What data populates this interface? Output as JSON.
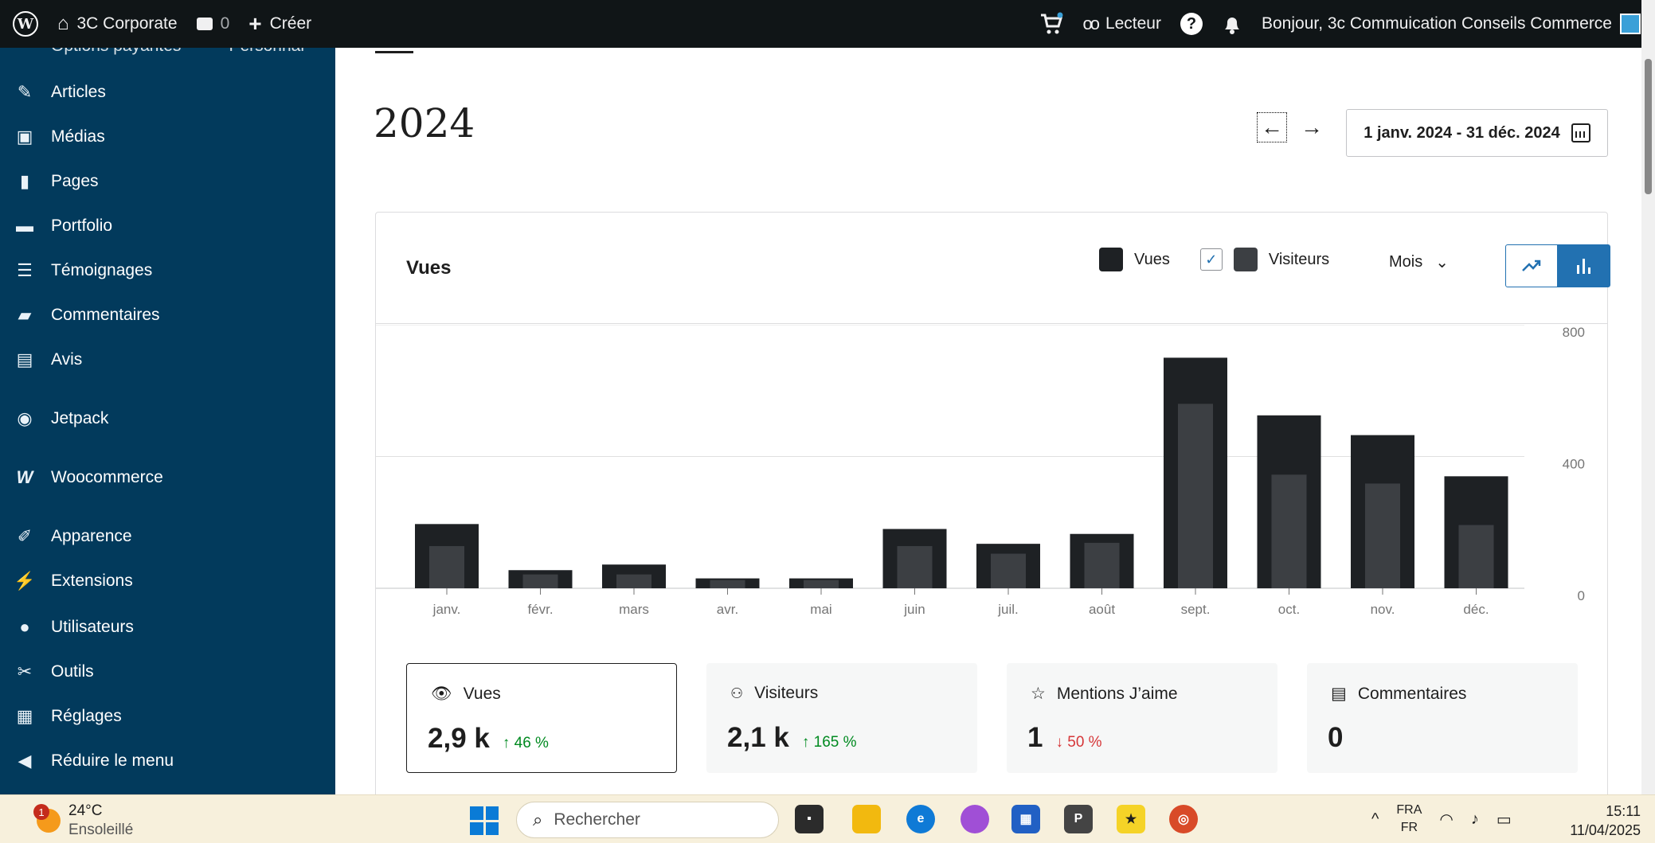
{
  "adminbar": {
    "site_name": "3C Corporate",
    "comments_count": "0",
    "create_label": "Créer",
    "reader_label": "Lecteur",
    "greeting": "Bonjour, 3c Commuication Conseils Commerce"
  },
  "sidebar": {
    "partial_top": [
      "Options payantes",
      "Personnal"
    ],
    "items": [
      {
        "label": "Articles",
        "icon": "pin-icon"
      },
      {
        "label": "Médias",
        "icon": "media-icon"
      },
      {
        "label": "Pages",
        "icon": "pages-icon"
      },
      {
        "label": "Portfolio",
        "icon": "folder-icon"
      },
      {
        "label": "Témoignages",
        "icon": "testimonial-icon"
      },
      {
        "label": "Commentaires",
        "icon": "comment-icon"
      },
      {
        "label": "Avis",
        "icon": "review-icon"
      },
      {
        "label": "Jetpack",
        "icon": "jetpack-icon"
      },
      {
        "label": "Woocommerce",
        "icon": "woocommerce-icon"
      },
      {
        "label": "Apparence",
        "icon": "brush-icon"
      },
      {
        "label": "Extensions",
        "icon": "plugin-icon"
      },
      {
        "label": "Utilisateurs",
        "icon": "user-icon"
      },
      {
        "label": "Outils",
        "icon": "wrench-icon"
      },
      {
        "label": "Réglages",
        "icon": "settings-icon"
      },
      {
        "label": "Réduire le menu",
        "icon": "collapse-icon"
      }
    ]
  },
  "main": {
    "year": "2024",
    "date_range": "1 janv. 2024 - 31 déc. 2024",
    "card_title": "Vues",
    "legend_views": "Vues",
    "legend_visitors": "Visiteurs",
    "period": "Mois"
  },
  "chart_data": {
    "type": "bar",
    "categories": [
      "janv.",
      "févr.",
      "mars",
      "avr.",
      "mai",
      "juin",
      "juil.",
      "août",
      "sept.",
      "oct.",
      "nov.",
      "déc."
    ],
    "series": [
      {
        "name": "Vues",
        "values": [
          195,
          55,
          72,
          30,
          30,
          180,
          135,
          165,
          700,
          525,
          465,
          340
        ],
        "color": "#1e2124"
      },
      {
        "name": "Visiteurs",
        "values": [
          128,
          42,
          42,
          25,
          25,
          128,
          105,
          138,
          560,
          345,
          318,
          192
        ],
        "color": "#3c3f43"
      }
    ],
    "yticks": [
      "800",
      "400",
      "0"
    ],
    "ylim": [
      0,
      800
    ],
    "grid": true,
    "legend": "top-right"
  },
  "stats": [
    {
      "label": "Vues",
      "value": "2,9 k",
      "change": "46 %",
      "direction": "up",
      "icon": "eye-icon"
    },
    {
      "label": "Visiteurs",
      "value": "2,1 k",
      "change": "165 %",
      "direction": "up",
      "icon": "people-icon"
    },
    {
      "label": "Mentions J’aime",
      "value": "1",
      "change": "50 %",
      "direction": "down",
      "icon": "star-icon"
    },
    {
      "label": "Commentaires",
      "value": "0",
      "change": "",
      "direction": "",
      "icon": "comment-box-icon"
    }
  ],
  "taskbar": {
    "weather_badge": "1",
    "temperature": "24°C",
    "weather": "Ensoleillé",
    "search_placeholder": "Rechercher",
    "lang_top": "FRA",
    "lang_bottom": "FR",
    "time": "15:11",
    "date": "11/04/2025"
  }
}
